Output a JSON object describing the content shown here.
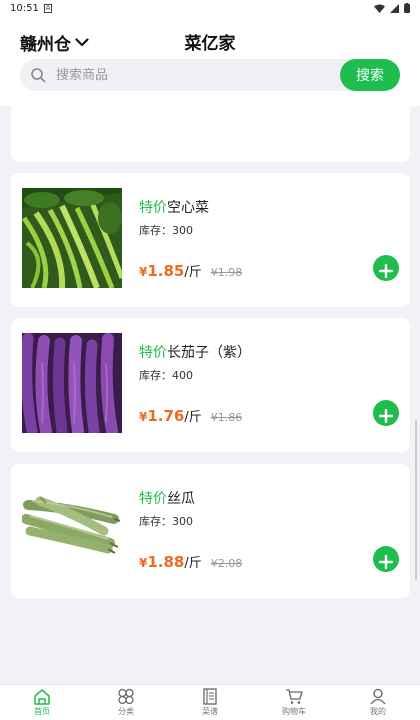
{
  "status_bar": {
    "time": "10:51",
    "notification_icon": "a-icon"
  },
  "header": {
    "location": "赣州仓",
    "title": "菜亿家"
  },
  "search": {
    "placeholder": "搜索商品",
    "button_label": "搜索"
  },
  "products": [
    {
      "tag": "特价",
      "name": "空心菜",
      "stock_label": "库存：300",
      "price_symbol": "¥",
      "price": "1.85",
      "unit": "/斤",
      "old_price": "¥1.98",
      "image_icon": "water-spinach-image"
    },
    {
      "tag": "特价",
      "name": "长茄子（紫）",
      "stock_label": "库存：400",
      "price_symbol": "¥",
      "price": "1.76",
      "unit": "/斤",
      "old_price": "¥1.86",
      "image_icon": "eggplant-image"
    },
    {
      "tag": "特价",
      "name": "丝瓜",
      "stock_label": "库存：300",
      "price_symbol": "¥",
      "price": "1.88",
      "unit": "/斤",
      "old_price": "¥2.08",
      "image_icon": "loofah-image"
    }
  ],
  "bottom_nav": [
    {
      "label": "首页",
      "icon": "home-icon",
      "active": true
    },
    {
      "label": "分类",
      "icon": "category-icon",
      "active": false
    },
    {
      "label": "菜谱",
      "icon": "recipe-icon",
      "active": false
    },
    {
      "label": "购物车",
      "icon": "cart-icon",
      "active": false
    },
    {
      "label": "我的",
      "icon": "profile-icon",
      "active": false
    }
  ],
  "colors": {
    "accent": "#1fbd4e",
    "price": "#f0691e",
    "background": "#f1f2f7"
  }
}
